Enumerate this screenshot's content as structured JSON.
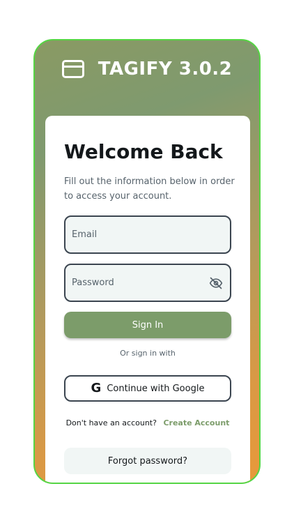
{
  "brand": {
    "title": "TAGIFY 3.0.2",
    "icon": "credit-card-icon"
  },
  "login": {
    "heading": "Welcome Back",
    "subtitle": "Fill out the information below in order to access your account.",
    "email": {
      "value": "",
      "placeholder": "Email"
    },
    "password": {
      "value": "",
      "placeholder": "Password",
      "visibility_icon": "eye-off-icon"
    },
    "sign_in_label": "Sign In",
    "or_text": "Or sign in with",
    "google_label": "Continue with Google",
    "google_icon": "google-icon",
    "no_account_text": "Don't have an account?",
    "create_account_label": "Create Account",
    "forgot_password_label": "Forgot password?"
  },
  "colors": {
    "accent": "#7c9c6a",
    "phone_border": "#55d544",
    "gradient_top": "#8a9a63",
    "gradient_bottom": "#e8993a",
    "field_bg": "#f1f6f5",
    "text_primary": "#14181b",
    "text_secondary": "#57636c"
  }
}
